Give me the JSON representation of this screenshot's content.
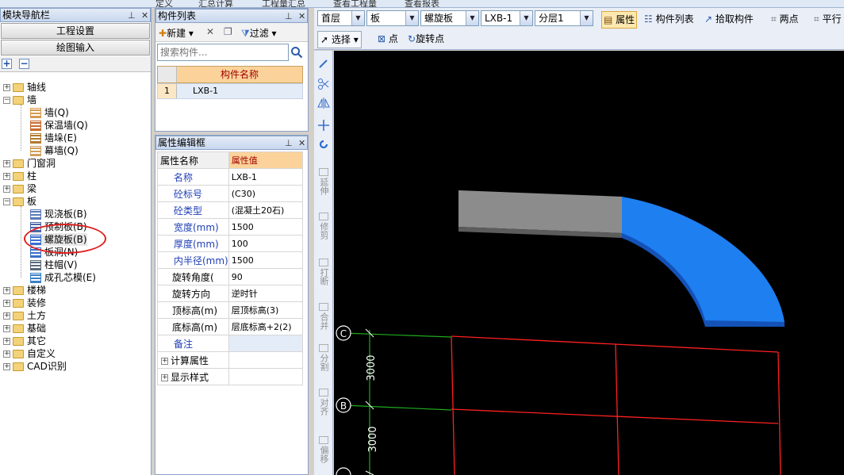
{
  "top_strip": [
    "定义",
    "汇总计算",
    "工程量汇总",
    "查看工程量",
    "查看报表"
  ],
  "nav": {
    "title": "模块导航栏",
    "btn_project": "工程设置",
    "btn_draw": "绘图输入",
    "tree": [
      {
        "label": "轴线",
        "type": "folder",
        "expanded": false
      },
      {
        "label": "墙",
        "type": "folder",
        "expanded": true
      },
      {
        "label": "墙(Q)",
        "type": "item"
      },
      {
        "label": "保温墙(Q)",
        "type": "item"
      },
      {
        "label": "墙垛(E)",
        "type": "item"
      },
      {
        "label": "幕墙(Q)",
        "type": "item"
      },
      {
        "label": "门窗洞",
        "type": "folder",
        "expanded": false
      },
      {
        "label": "柱",
        "type": "folder",
        "expanded": false
      },
      {
        "label": "梁",
        "type": "folder",
        "expanded": false
      },
      {
        "label": "板",
        "type": "folder",
        "expanded": true
      },
      {
        "label": "现浇板(B)",
        "type": "item"
      },
      {
        "label": "预制板(B)",
        "type": "item"
      },
      {
        "label": "螺旋板(B)",
        "type": "item",
        "selected": true
      },
      {
        "label": "板洞(N)",
        "type": "item"
      },
      {
        "label": "柱帽(V)",
        "type": "item"
      },
      {
        "label": "成孔芯模(E)",
        "type": "item"
      },
      {
        "label": "楼梯",
        "type": "folder",
        "expanded": false
      },
      {
        "label": "装修",
        "type": "folder",
        "expanded": false
      },
      {
        "label": "土方",
        "type": "folder",
        "expanded": false
      },
      {
        "label": "基础",
        "type": "folder",
        "expanded": false
      },
      {
        "label": "其它",
        "type": "folder",
        "expanded": false
      },
      {
        "label": "自定义",
        "type": "folder",
        "expanded": false
      },
      {
        "label": "CAD识别",
        "type": "folder",
        "expanded": false
      }
    ]
  },
  "complist": {
    "title": "构件列表",
    "new_label": "新建",
    "filter_label": "过滤",
    "search_placeholder": "搜索构件...",
    "column": "构件名称",
    "rows": [
      {
        "idx": "1",
        "name": "LXB-1"
      }
    ]
  },
  "props": {
    "title": "属性编辑框",
    "head_key": "属性名称",
    "head_val": "属性值",
    "rows": [
      {
        "k": "名称",
        "v": "LXB-1",
        "blue": true
      },
      {
        "k": "砼标号",
        "v": "(C30)",
        "blue": true
      },
      {
        "k": "砼类型",
        "v": "(混凝土20石)",
        "blue": true
      },
      {
        "k": "宽度(mm)",
        "v": "1500",
        "blue": true
      },
      {
        "k": "厚度(mm)",
        "v": "100",
        "blue": true
      },
      {
        "k": "内半径(mm)",
        "v": "1500",
        "blue": true
      },
      {
        "k": "旋转角度(",
        "v": "90",
        "blue": false
      },
      {
        "k": "旋转方向",
        "v": "逆时针",
        "blue": false
      },
      {
        "k": "顶标高(m)",
        "v": "层顶标高(3)",
        "blue": false
      },
      {
        "k": "底标高(m)",
        "v": "层底标高+2(2)",
        "blue": false
      },
      {
        "k": "备注",
        "v": "",
        "blue": true
      }
    ],
    "groups": [
      "计算属性",
      "显示样式"
    ]
  },
  "toolbar": {
    "floor": "首层",
    "type": "板",
    "subtype": "螺旋板",
    "component": "LXB-1",
    "layer": "分层1",
    "attr_btn": "属性",
    "list_btn": "构件列表",
    "pick_btn": "拾取构件",
    "two_point": "两点",
    "parallel": "平行",
    "select_btn": "选择",
    "point_btn": "点",
    "rotate_point_btn": "旋转点"
  },
  "vtools": [
    "延伸",
    "修剪",
    "打断",
    "合并",
    "分割",
    "对齐",
    "偏移"
  ],
  "canvas": {
    "axis_labels": [
      "C",
      "B"
    ],
    "dimensions": [
      "3000",
      "3000"
    ],
    "colors": {
      "slab_gray": "#8c8c8c",
      "slab_blue": "#1e7ff0",
      "grid_red": "#ff2020",
      "grid_green": "#1faa1f",
      "bg": "#000000"
    }
  }
}
